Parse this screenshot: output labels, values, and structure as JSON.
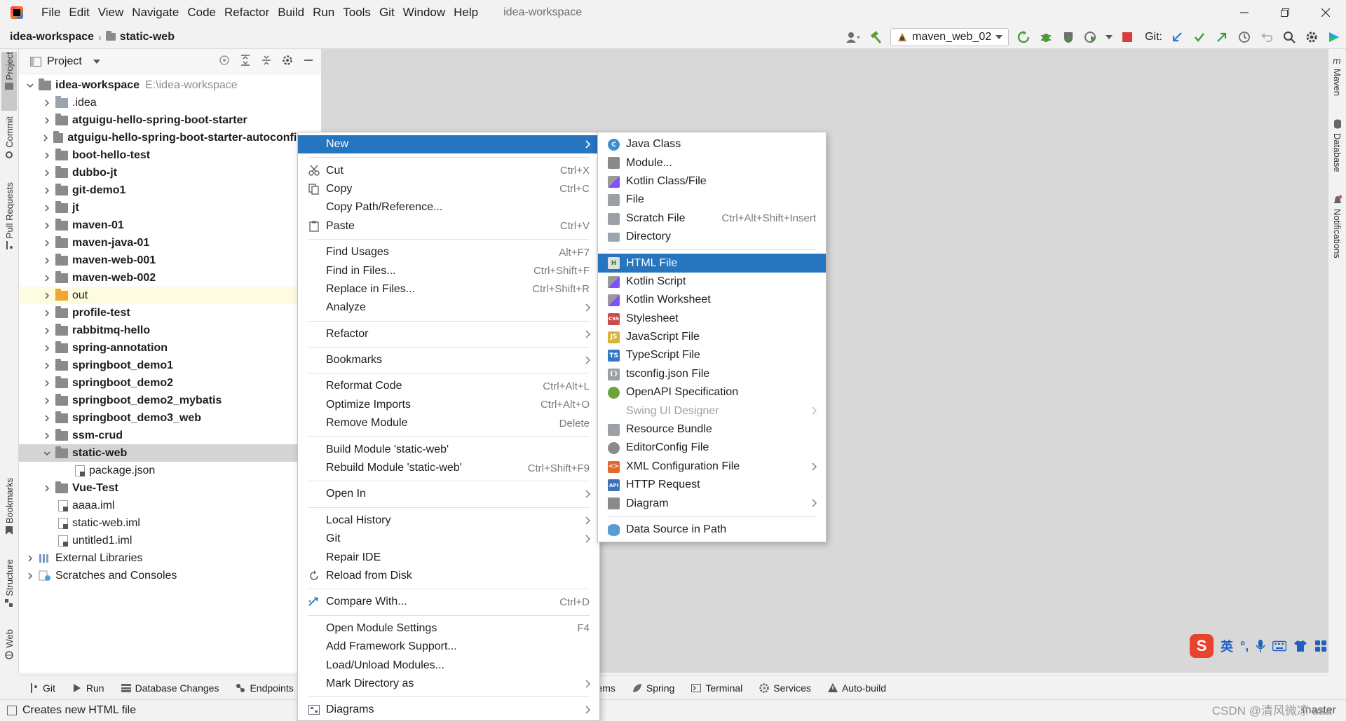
{
  "titlebar": {
    "menus": [
      "File",
      "Edit",
      "View",
      "Navigate",
      "Code",
      "Refactor",
      "Build",
      "Run",
      "Tools",
      "Git",
      "Window",
      "Help"
    ],
    "title": "idea-workspace"
  },
  "navbar": {
    "breadcrumb_root": "idea-workspace",
    "breadcrumb_module": "static-web",
    "run_config": "maven_web_02",
    "git_label": "Git:"
  },
  "left_tabs": {
    "project": "Project",
    "commit": "Commit",
    "pull_requests": "Pull Requests",
    "bookmarks": "Bookmarks",
    "structure": "Structure",
    "web": "Web"
  },
  "right_tabs": {
    "maven": "Maven",
    "database": "Database",
    "notifications": "Notifications"
  },
  "project_panel": {
    "title": "Project",
    "root_name": "idea-workspace",
    "root_path": "E:\\idea-workspace",
    "items": [
      {
        "name": ".idea",
        "kind": "plain",
        "bold": false
      },
      {
        "name": "atguigu-hello-spring-boot-starter",
        "kind": "module",
        "bold": true
      },
      {
        "name": "atguigu-hello-spring-boot-starter-autoconfigure",
        "kind": "module",
        "bold": true
      },
      {
        "name": "boot-hello-test",
        "kind": "module",
        "bold": true
      },
      {
        "name": "dubbo-jt",
        "kind": "module",
        "bold": true
      },
      {
        "name": "git-demo1",
        "kind": "module",
        "bold": true
      },
      {
        "name": "jt",
        "kind": "module",
        "bold": true
      },
      {
        "name": "maven-01",
        "kind": "module",
        "bold": true
      },
      {
        "name": "maven-java-01",
        "kind": "module",
        "bold": true
      },
      {
        "name": "maven-web-001",
        "kind": "module",
        "bold": true
      },
      {
        "name": "maven-web-002",
        "kind": "module",
        "bold": true
      },
      {
        "name": "out",
        "kind": "orange",
        "bold": false
      },
      {
        "name": "profile-test",
        "kind": "module",
        "bold": true
      },
      {
        "name": "rabbitmq-hello",
        "kind": "module",
        "bold": true
      },
      {
        "name": "spring-annotation",
        "kind": "module",
        "bold": true
      },
      {
        "name": "springboot_demo1",
        "kind": "module",
        "bold": true
      },
      {
        "name": "springboot_demo2",
        "kind": "module",
        "bold": true
      },
      {
        "name": "springboot_demo2_mybatis",
        "kind": "module",
        "bold": true
      },
      {
        "name": "springboot_demo3_web",
        "kind": "module",
        "bold": true
      },
      {
        "name": "ssm-crud",
        "kind": "module",
        "bold": true
      }
    ],
    "static_web": "static-web",
    "package_json": "package.json",
    "vue_test": "Vue-Test",
    "files": [
      "aaaa.iml",
      "static-web.iml",
      "untitled1.iml"
    ],
    "external_libraries": "External Libraries",
    "scratches": "Scratches and Consoles"
  },
  "context_menu": {
    "new": "New",
    "cut": "Cut",
    "cut_sc": "Ctrl+X",
    "copy": "Copy",
    "copy_sc": "Ctrl+C",
    "copy_path": "Copy Path/Reference...",
    "paste": "Paste",
    "paste_sc": "Ctrl+V",
    "find_usages": "Find Usages",
    "find_usages_sc": "Alt+F7",
    "find_in_files": "Find in Files...",
    "find_in_files_sc": "Ctrl+Shift+F",
    "replace_in_files": "Replace in Files...",
    "replace_in_files_sc": "Ctrl+Shift+R",
    "analyze": "Analyze",
    "refactor": "Refactor",
    "bookmarks": "Bookmarks",
    "reformat": "Reformat Code",
    "reformat_sc": "Ctrl+Alt+L",
    "optimize": "Optimize Imports",
    "optimize_sc": "Ctrl+Alt+O",
    "remove_module": "Remove Module",
    "remove_module_sc": "Delete",
    "build_module": "Build Module 'static-web'",
    "rebuild_module": "Rebuild Module 'static-web'",
    "rebuild_module_sc": "Ctrl+Shift+F9",
    "open_in": "Open In",
    "local_history": "Local History",
    "git": "Git",
    "repair_ide": "Repair IDE",
    "reload": "Reload from Disk",
    "compare": "Compare With...",
    "compare_sc": "Ctrl+D",
    "module_settings": "Open Module Settings",
    "module_settings_sc": "F4",
    "framework": "Add Framework Support...",
    "load_unload": "Load/Unload Modules...",
    "mark_dir": "Mark Directory as",
    "diagrams": "Diagrams"
  },
  "new_submenu": {
    "java_class": "Java Class",
    "module": "Module...",
    "kotlin_class": "Kotlin Class/File",
    "file": "File",
    "scratch": "Scratch File",
    "scratch_sc": "Ctrl+Alt+Shift+Insert",
    "directory": "Directory",
    "html_file": "HTML File",
    "kotlin_script": "Kotlin Script",
    "kotlin_worksheet": "Kotlin Worksheet",
    "stylesheet": "Stylesheet",
    "js_file": "JavaScript File",
    "ts_file": "TypeScript File",
    "tsconfig": "tsconfig.json File",
    "openapi": "OpenAPI Specification",
    "swing": "Swing UI Designer",
    "resource_bundle": "Resource Bundle",
    "editorconfig": "EditorConfig File",
    "xml_config": "XML Configuration File",
    "http_request": "HTTP Request",
    "diagram": "Diagram",
    "data_source": "Data Source in Path"
  },
  "bottom_tabs": {
    "git": "Git",
    "run": "Run",
    "db_changes": "Database Changes",
    "endpoints": "Endpoints",
    "problems": "Problems",
    "spring": "Spring",
    "terminal": "Terminal",
    "services": "Services",
    "auto_build": "Auto-build"
  },
  "status_bar": {
    "message": "Creates new HTML file",
    "branch": "master"
  },
  "ime": {
    "logo": "S",
    "lang": "英",
    "punct": "°,"
  },
  "watermark": "CSDN @清风微凉 aaa",
  "colors": {
    "highlight": "#2675bf",
    "editor_bg": "#d8d8d8",
    "panel_bg": "#ffffff"
  }
}
